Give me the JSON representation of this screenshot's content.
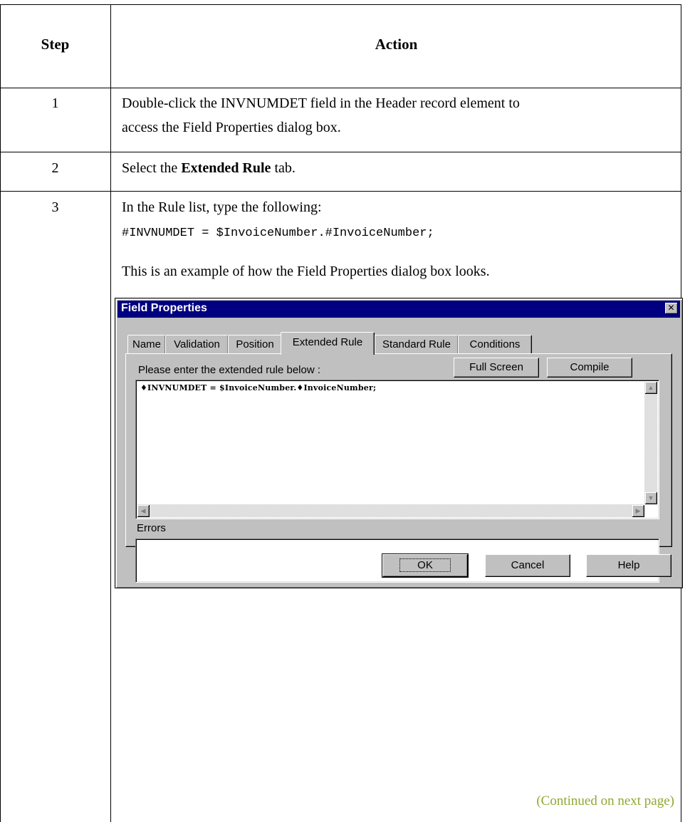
{
  "table": {
    "header_step": "Step",
    "header_action": "Action"
  },
  "steps": [
    {
      "number": "1",
      "line1": "Double-click the INVNUMDET field in the Header record element to",
      "line2": "access the Field Properties dialog box."
    },
    {
      "number": "2",
      "prefix": "Select the ",
      "bold": "Extended Rule",
      "suffix": " tab."
    },
    {
      "number": "3",
      "intro": "In the Rule list, type the following:",
      "code": "#INVNUMDET = $InvoiceNumber.#InvoiceNumber;",
      "note": "This is an example of how the Field Properties dialog box looks."
    }
  ],
  "dialog": {
    "title": "Field Properties",
    "close_glyph": "✕",
    "tabs": [
      "Name",
      "Validation",
      "Position",
      "Extended Rule",
      "Standard Rule",
      "Conditions"
    ],
    "active_tab": "Extended Rule",
    "prompt": "Please enter the extended rule below :",
    "full_screen_button": "Full Screen",
    "compile_button": "Compile",
    "rule_text": "♦INVNUMDET = $InvoiceNumber.♦InvoiceNumber;",
    "errors_label": "Errors",
    "ok_button": "OK",
    "cancel_button": "Cancel",
    "help_button": "Help"
  },
  "footer": {
    "continued": "(Continued on next page)"
  },
  "colors": {
    "titlebar": "#000080",
    "dialog_face": "#c0c0c0",
    "continued_text": "#8fa832"
  }
}
